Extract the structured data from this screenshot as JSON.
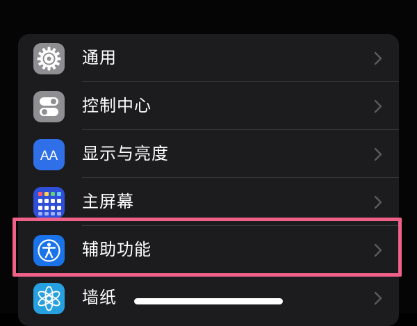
{
  "settings": {
    "items": [
      {
        "label": "通用",
        "icon": "gear-icon",
        "icon_color": "#8e8e93"
      },
      {
        "label": "控制中心",
        "icon": "toggles-icon",
        "icon_color": "#8e8e93"
      },
      {
        "label": "显示与亮度",
        "icon": "text-size-icon",
        "icon_color": "#2f6fe8",
        "icon_text": "AA"
      },
      {
        "label": "主屏幕",
        "icon": "home-screen-grid-icon",
        "icon_color": "#2f4fd8"
      },
      {
        "label": "辅助功能",
        "icon": "accessibility-icon",
        "icon_color": "#1a73e8"
      },
      {
        "label": "墙纸",
        "icon": "wallpaper-flower-icon",
        "icon_color": "#27a0e0"
      }
    ],
    "highlighted_item": "辅助功能",
    "highlight_color": "#f0618a"
  }
}
